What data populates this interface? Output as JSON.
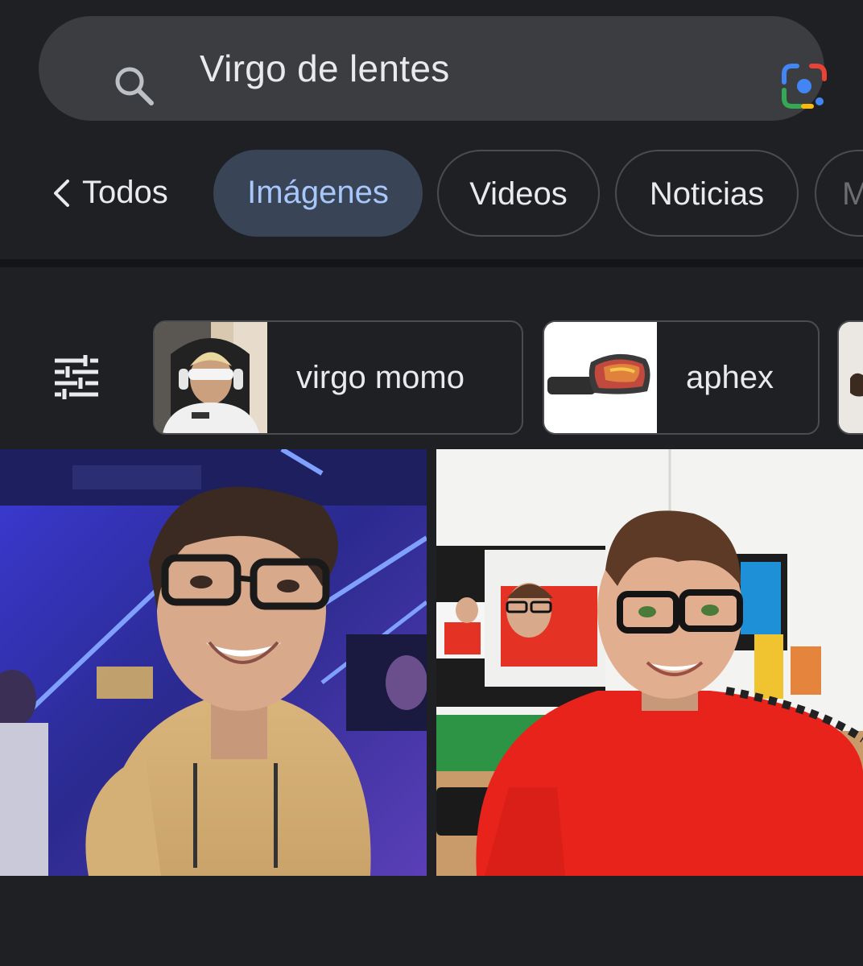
{
  "search": {
    "query": "Virgo de lentes"
  },
  "tabs": {
    "back_label": "Todos",
    "items": [
      {
        "label": "Imágenes",
        "active": true
      },
      {
        "label": "Videos",
        "active": false
      },
      {
        "label": "Noticias",
        "active": false
      }
    ],
    "overflow_label": "M"
  },
  "chips": [
    {
      "label": "virgo momo"
    },
    {
      "label": "aphex"
    }
  ],
  "results": [
    {
      "alt_hint": "photo"
    },
    {
      "alt_hint": "photo"
    }
  ],
  "colors": {
    "background": "#1f2023",
    "searchbar": "#3c3d40",
    "active_tab_bg": "#394457",
    "active_tab_text": "#a8c7fa"
  }
}
